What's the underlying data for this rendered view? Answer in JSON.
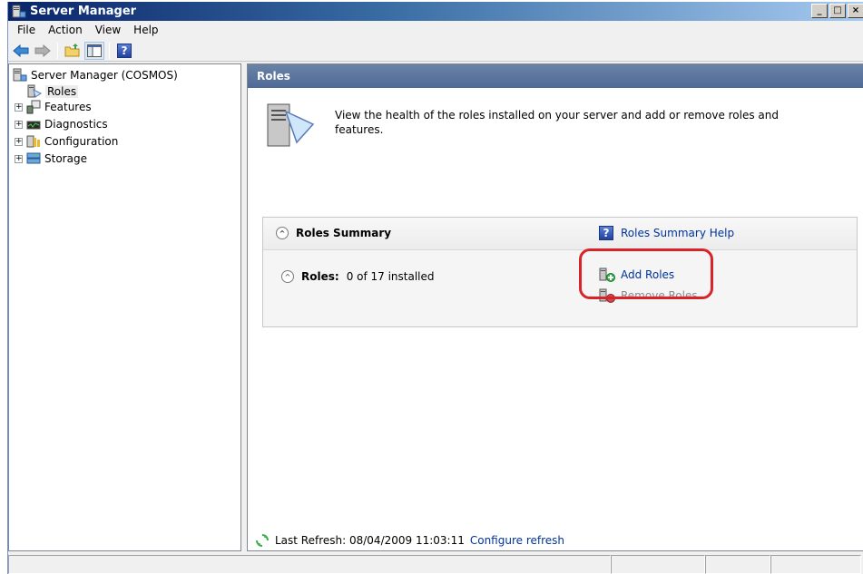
{
  "window": {
    "title": "Server Manager",
    "controls": [
      "_",
      "□",
      "×"
    ]
  },
  "menubar": {
    "items": [
      "File",
      "Action",
      "View",
      "Help"
    ]
  },
  "toolbar": {
    "buttons": [
      "back-icon",
      "forward-icon",
      "up-folder-icon",
      "show-hide-console-tree-icon",
      "help-icon"
    ]
  },
  "tree": {
    "root": "Server Manager (COSMOS)",
    "items": [
      {
        "label": "Roles",
        "selected": true,
        "expandable": false
      },
      {
        "label": "Features",
        "expandable": true
      },
      {
        "label": "Diagnostics",
        "expandable": true
      },
      {
        "label": "Configuration",
        "expandable": true
      },
      {
        "label": "Storage",
        "expandable": true
      }
    ],
    "expander_glyph": "+"
  },
  "content": {
    "header": "Roles",
    "intro": "View the health of the roles installed on your server and add or remove roles and features.",
    "summary": {
      "title": "Roles Summary",
      "help_link": "Roles Summary Help",
      "roles_label": "Roles:",
      "roles_value": "0 of 17 installed",
      "add_roles": "Add Roles",
      "remove_roles": "Remove Roles"
    },
    "status": {
      "last_refresh": "Last Refresh: 08/04/2009 11:03:11",
      "configure_refresh": "Configure refresh"
    }
  },
  "colors": {
    "title_gradient_start": "#0a246a",
    "link": "#003399",
    "highlight": "#d8232a",
    "pane_header": "#5a7399"
  }
}
